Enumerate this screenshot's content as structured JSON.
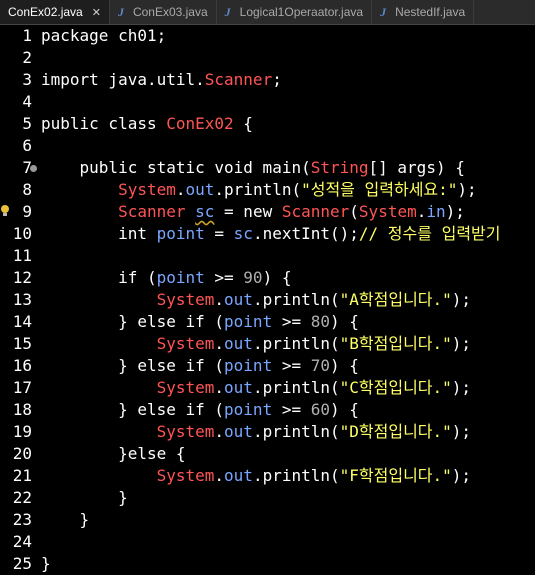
{
  "tabs": [
    {
      "label": "ConEx02.java",
      "active": true,
      "closable": true
    },
    {
      "label": "ConEx03.java",
      "active": false
    },
    {
      "label": "Logical1Operaator.java",
      "active": false
    },
    {
      "label": "NestedIf.java",
      "active": false
    }
  ],
  "lines": [
    {
      "n": "1",
      "t": "package ch01;"
    },
    {
      "n": "2",
      "t": ""
    },
    {
      "n": "3",
      "t": "import java.util.Scanner;"
    },
    {
      "n": "4",
      "t": ""
    },
    {
      "n": "5",
      "t": "public class ConEx02 {"
    },
    {
      "n": "6",
      "t": ""
    },
    {
      "n": "7",
      "t": "    public static void main(String[] args) {"
    },
    {
      "n": "8",
      "t": "        System.out.println(\"성적을 입력하세요:\");"
    },
    {
      "n": "9",
      "t": "        Scanner sc = new Scanner(System.in);"
    },
    {
      "n": "10",
      "t": "        int point = sc.nextInt();// 정수를 입력받기"
    },
    {
      "n": "11",
      "t": ""
    },
    {
      "n": "12",
      "t": "        if (point >= 90) {"
    },
    {
      "n": "13",
      "t": "            System.out.println(\"A학점입니다.\");"
    },
    {
      "n": "14",
      "t": "        } else if (point >= 80) {"
    },
    {
      "n": "15",
      "t": "            System.out.println(\"B학점입니다.\");"
    },
    {
      "n": "16",
      "t": "        } else if (point >= 70) {"
    },
    {
      "n": "17",
      "t": "            System.out.println(\"C학점입니다.\");"
    },
    {
      "n": "18",
      "t": "        } else if (point >= 60) {"
    },
    {
      "n": "19",
      "t": "            System.out.println(\"D학점입니다.\");"
    },
    {
      "n": "20",
      "t": "        }else {"
    },
    {
      "n": "21",
      "t": "            System.out.println(\"F학점입니다.\");"
    },
    {
      "n": "22",
      "t": "        }"
    },
    {
      "n": "23",
      "t": "    }"
    },
    {
      "n": "24",
      "t": ""
    },
    {
      "n": "25",
      "t": "}"
    }
  ],
  "colors": {
    "background": "#000000",
    "keyword": "#ffffff",
    "type": "#ff5555",
    "field": "#7aa6ff",
    "string": "#ffff66"
  }
}
